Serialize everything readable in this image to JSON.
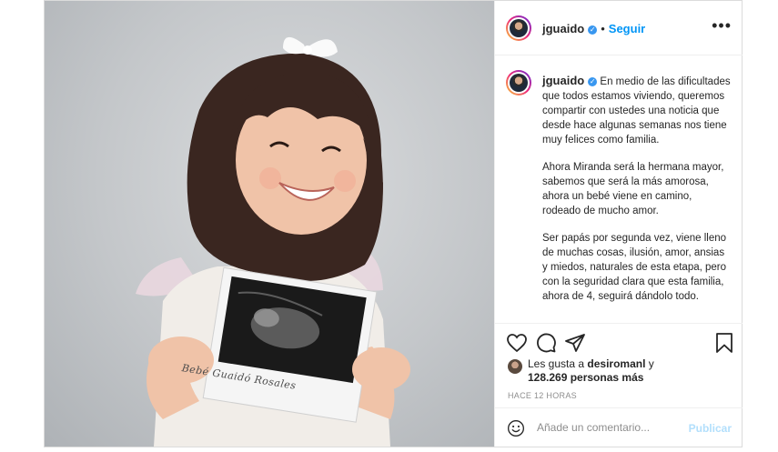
{
  "post": {
    "username": "jguaido",
    "follow_label": "Seguir",
    "dot": "•",
    "more_label": "•••",
    "caption": {
      "username": "jguaido",
      "paragraphs": [
        "En medio de las dificultades que todos estamos viviendo, queremos compartir con ustedes una noticia que desde hace algunas semanas nos tiene muy felices como familia.",
        "Ahora Miranda será la hermana mayor, sabemos que será la más amorosa, ahora un bebé viene en camino, rodeado de mucho amor.",
        "Ser papás por segunda vez, viene lleno de muchas cosas, ilusión, amor, ansias y miedos, naturales de esta etapa, pero con la seguridad clara que esta familia, ahora de 4, seguirá dándolo todo."
      ]
    },
    "likes": {
      "prefix": "Les gusta a",
      "user": "desiromanl",
      "conj": "y",
      "count": "128.269 personas más"
    },
    "timestamp": "HACE 12 HORAS",
    "comment": {
      "placeholder": "Añade un comentario...",
      "publish_label": "Publicar"
    },
    "photo_card_text": "Bebé Guaidó Rosales"
  },
  "icons": {
    "like": "heart-icon",
    "comment": "comment-icon",
    "share": "share-icon",
    "save": "bookmark-icon",
    "emoji": "emoji-icon",
    "verified": "verified-badge-icon",
    "more": "more-options-icon"
  },
  "colors": {
    "accent": "#0095f6",
    "verified": "#3897f0",
    "muted": "#8e8e8e",
    "publish_disabled": "#b2dffc",
    "border": "#dbdbdb"
  }
}
